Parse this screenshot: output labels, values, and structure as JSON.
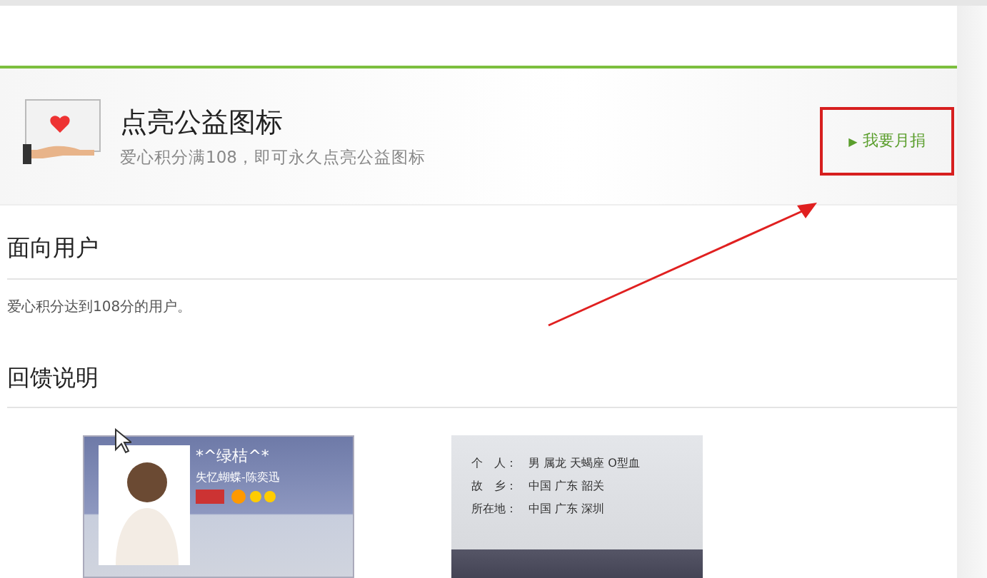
{
  "header": {
    "title": "点亮公益图标",
    "subtitle": "爱心积分满108，即可永久点亮公益图标",
    "button": {
      "arrow": "▶",
      "label": "我要月捐",
      "highlighted": true
    }
  },
  "sections": [
    {
      "heading": "面向用户",
      "text": "爱心积分达到108分的用户。"
    },
    {
      "heading": "回馈说明"
    }
  ],
  "profile_card": {
    "nickname": "*^绿桔^*",
    "song": "失忆蝴蝶-陈奕迅"
  },
  "info_card": {
    "rows": [
      {
        "label": "个　人：",
        "value": "男  属龙  天蝎座  O型血"
      },
      {
        "label": "故　乡：",
        "value": "中国 广东 韶关"
      },
      {
        "label": "所在地：",
        "value": "中国 广东 深圳"
      }
    ]
  }
}
